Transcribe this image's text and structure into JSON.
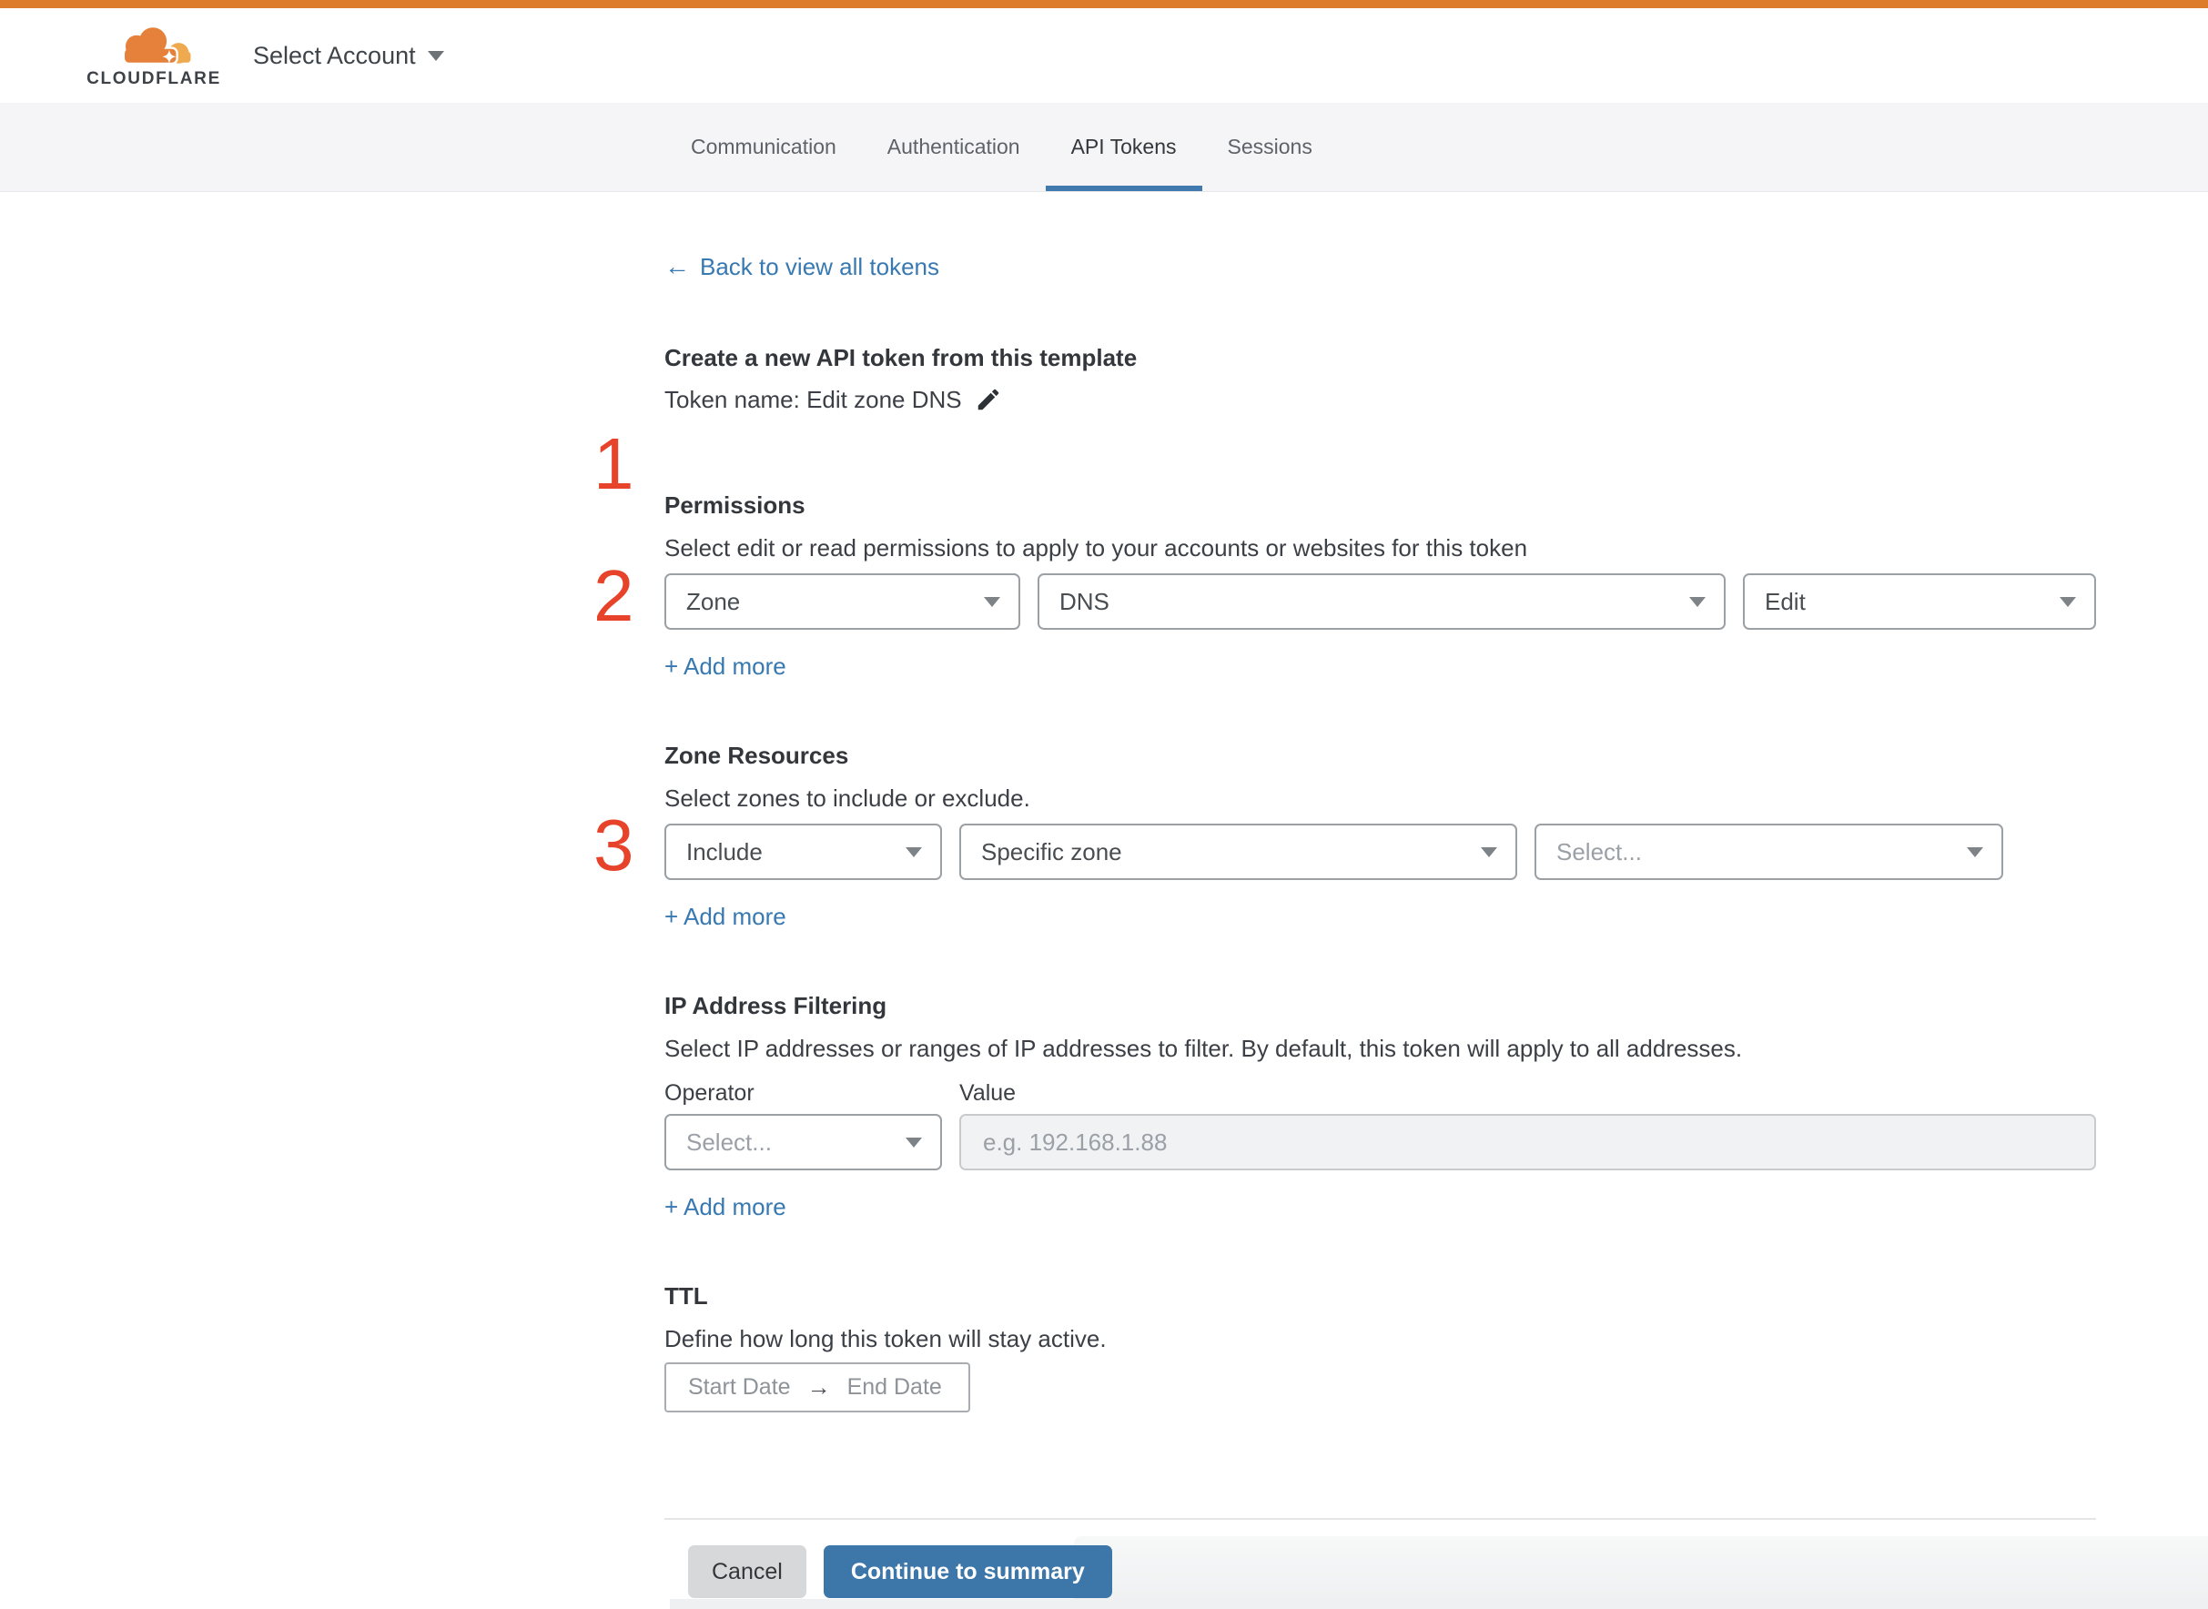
{
  "header": {
    "brand_text": "CLOUDFLARE",
    "account_selector_label": "Select Account"
  },
  "tabs": [
    {
      "label": "Communication"
    },
    {
      "label": "Authentication"
    },
    {
      "label": "API Tokens"
    },
    {
      "label": "Sessions"
    }
  ],
  "active_tab": "API Tokens",
  "back_arrow": "←",
  "back_link_label": "Back to view all tokens",
  "create_section": {
    "step": "1",
    "title": "Create a new API token from this template",
    "token_name_line": "Token name: Edit zone DNS"
  },
  "permissions": {
    "step": "2",
    "heading": "Permissions",
    "description": "Select edit or read permissions to apply to your accounts or websites for this token",
    "scope_value": "Zone",
    "service_value": "DNS",
    "access_value": "Edit",
    "add_more_label": "+ Add more"
  },
  "zone_resources": {
    "step": "3",
    "heading": "Zone Resources",
    "description": "Select zones to include or exclude.",
    "mode_value": "Include",
    "type_value": "Specific zone",
    "zone_placeholder": "Select...",
    "add_more_label": "+ Add more"
  },
  "ip_filtering": {
    "heading": "IP Address Filtering",
    "description": "Select IP addresses or ranges of IP addresses to filter. By default, this token will apply to all addresses.",
    "operator_label": "Operator",
    "value_label": "Value",
    "operator_placeholder": "Select...",
    "value_placeholder": "e.g. 192.168.1.88",
    "add_more_label": "+ Add more"
  },
  "ttl": {
    "heading": "TTL",
    "description": "Define how long this token will stay active.",
    "start_label": "Start Date",
    "range_arrow": "→",
    "end_label": "End Date"
  },
  "footer": {
    "cancel_label": "Cancel",
    "continue_label": "Continue to summary"
  },
  "colors": {
    "brand_orange": "#dd7c2b",
    "link_blue": "#3879b2",
    "step_number_red": "#e7432b",
    "primary_button_blue": "#3d76a9",
    "active_tab_underline": "#417aae"
  }
}
